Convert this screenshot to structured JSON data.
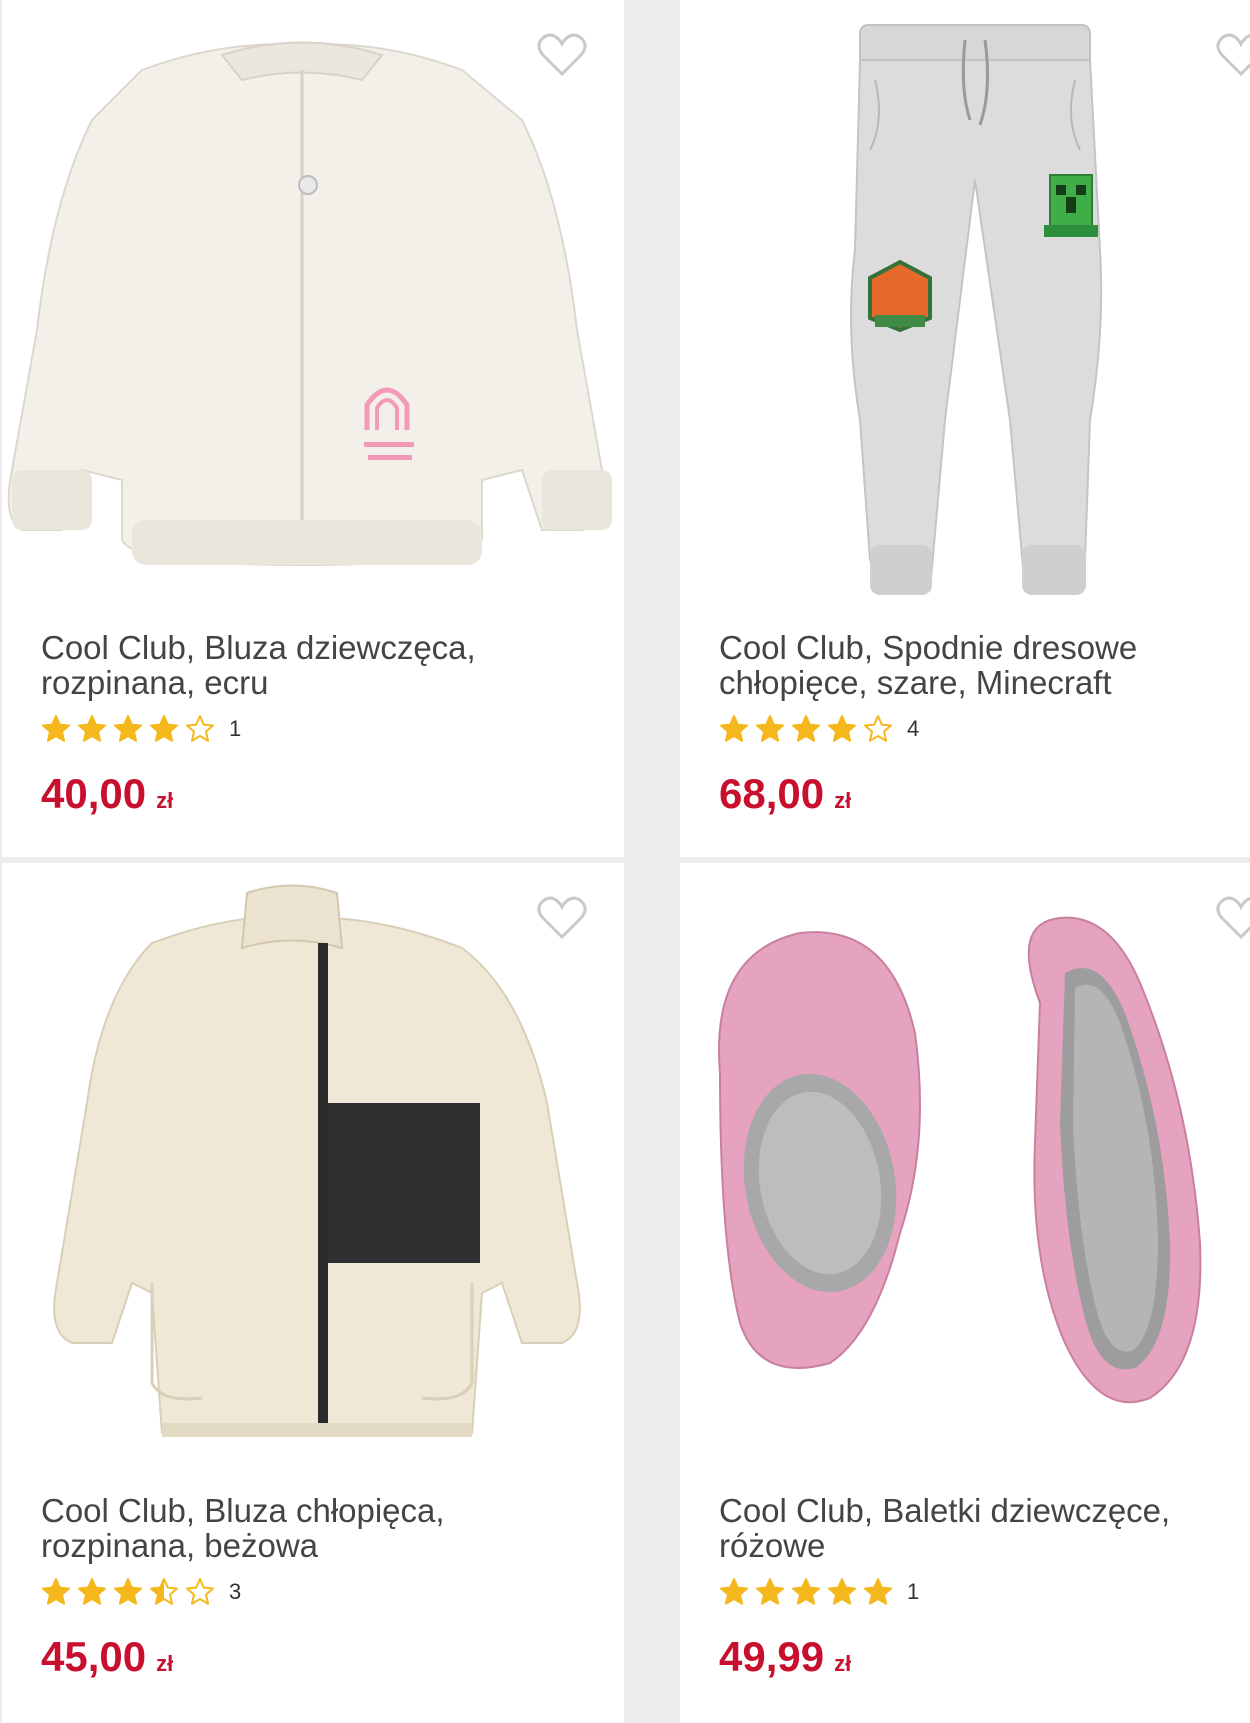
{
  "products": [
    {
      "title_line1": "Cool Club, Bluza dziewczęca,",
      "title_line2": "rozpinana, ecru",
      "rating_count": "1",
      "rating": 4,
      "price": "40,00",
      "currency": "zł",
      "image_icon": "white-zip-sweatshirt"
    },
    {
      "title_line1": "Cool Club, Spodnie dresowe",
      "title_line2": "chłopięce, szare, Minecraft",
      "rating_count": "4",
      "rating": 4,
      "price": "68,00",
      "currency": "zł",
      "image_icon": "grey-jogger-pants"
    },
    {
      "title_line1": "Cool Club, Bluza chłopięca,",
      "title_line2": "rozpinana, beżowa",
      "rating_count": "3",
      "rating": 3.5,
      "price": "45,00",
      "currency": "zł",
      "image_icon": "beige-fleece-jacket"
    },
    {
      "title_line1": "Cool Club, Baletki dziewczęce,",
      "title_line2": "różowe",
      "rating_count": "1",
      "rating": 5,
      "price": "49,99",
      "currency": "zł",
      "image_icon": "pink-ballet-shoes"
    }
  ],
  "colors": {
    "price": "#c8102e",
    "star": "#f5b81c",
    "heart_outline": "#c9c9c9",
    "background": "#ececec"
  }
}
